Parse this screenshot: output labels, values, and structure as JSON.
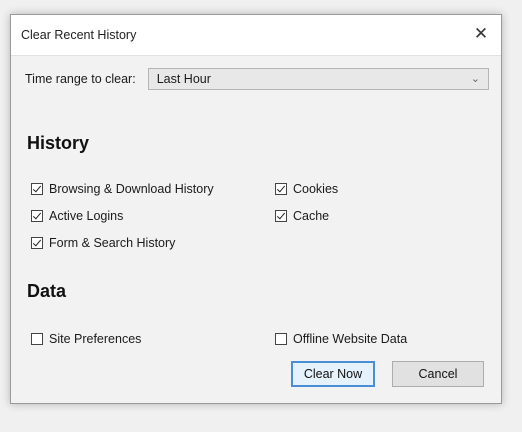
{
  "dialog": {
    "title": "Clear Recent History",
    "close_glyph": "✕"
  },
  "time_range": {
    "label": "Time range to clear:",
    "selected": "Last Hour"
  },
  "history": {
    "heading": "History",
    "items": [
      {
        "label": "Browsing & Download History",
        "checked": true
      },
      {
        "label": "Cookies",
        "checked": true
      },
      {
        "label": "Active Logins",
        "checked": true
      },
      {
        "label": "Cache",
        "checked": true
      },
      {
        "label": "Form & Search History",
        "checked": true
      }
    ]
  },
  "data": {
    "heading": "Data",
    "items": [
      {
        "label": "Site Preferences",
        "checked": false
      },
      {
        "label": "Offline Website Data",
        "checked": false
      }
    ]
  },
  "buttons": {
    "clear_now": "Clear Now",
    "cancel": "Cancel"
  }
}
